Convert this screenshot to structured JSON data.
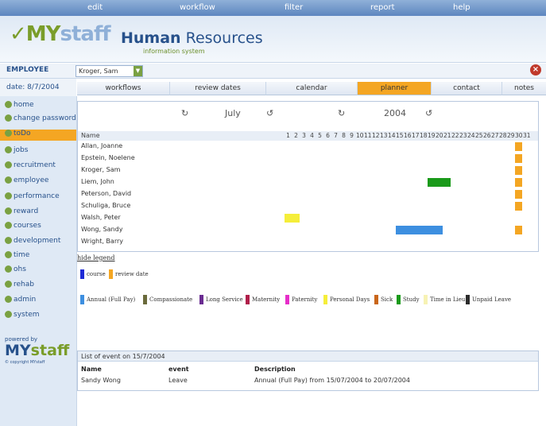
{
  "top_menu": {
    "items": [
      "edit",
      "workflow",
      "filter",
      "report",
      "help"
    ]
  },
  "header": {
    "logo_my": "MY",
    "logo_staff": "staff",
    "title_bold": "Human",
    "title_rest": " Resources",
    "subtitle": "information system"
  },
  "employee": {
    "label": "EMPLOYEE",
    "selected": "Kroger, Sam"
  },
  "date_label": "date: 8/7/2004",
  "tabs": [
    {
      "label": "workflows",
      "active": false
    },
    {
      "label": "review dates",
      "active": false
    },
    {
      "label": "calendar",
      "active": false
    },
    {
      "label": "planner",
      "active": true
    },
    {
      "label": "contact",
      "active": false
    },
    {
      "label": "notes",
      "active": false
    }
  ],
  "sidebar": {
    "items": [
      {
        "label": "home",
        "active": false
      },
      {
        "label": "change password",
        "active": false
      },
      {
        "label": "toDo",
        "active": true
      },
      {
        "label": "jobs",
        "active": false
      },
      {
        "label": "recruitment",
        "active": false
      },
      {
        "label": "employee",
        "active": false
      },
      {
        "label": "performance",
        "active": false
      },
      {
        "label": "reward",
        "active": false
      },
      {
        "label": "courses",
        "active": false
      },
      {
        "label": "development",
        "active": false
      },
      {
        "label": "time",
        "active": false
      },
      {
        "label": "ohs",
        "active": false
      },
      {
        "label": "rehab",
        "active": false
      },
      {
        "label": "admin",
        "active": false
      },
      {
        "label": "system",
        "active": false
      }
    ],
    "powered_by": "powered by",
    "logo_my": "MY",
    "logo_staff": "staff",
    "copyright": "© copyright MYstaff"
  },
  "planner": {
    "month": "July",
    "year": "2004",
    "name_header": "Name",
    "days": [
      "1",
      "2",
      "3",
      "4",
      "5",
      "6",
      "7",
      "8",
      "9",
      "10",
      "11",
      "12",
      "13",
      "14",
      "15",
      "16",
      "17",
      "18",
      "19",
      "20",
      "21",
      "22",
      "23",
      "24",
      "25",
      "26",
      "27",
      "28",
      "29",
      "30",
      "31"
    ],
    "employees": [
      {
        "name": "Allan, Joanne",
        "events": [
          {
            "type": "review",
            "start": 30,
            "end": 30
          }
        ]
      },
      {
        "name": "Epstein, Noelene",
        "events": [
          {
            "type": "review",
            "start": 30,
            "end": 30
          }
        ]
      },
      {
        "name": "Kroger, Sam",
        "events": [
          {
            "type": "review",
            "start": 30,
            "end": 30
          }
        ]
      },
      {
        "name": "Liem, John",
        "events": [
          {
            "type": "study",
            "start": 19,
            "end": 21
          },
          {
            "type": "review",
            "start": 30,
            "end": 30
          }
        ]
      },
      {
        "name": "Peterson, David",
        "events": [
          {
            "type": "review",
            "start": 30,
            "end": 30
          }
        ]
      },
      {
        "name": "Schuliga, Bruce",
        "events": [
          {
            "type": "review",
            "start": 30,
            "end": 30
          }
        ]
      },
      {
        "name": "Walsh, Peter",
        "events": [
          {
            "type": "personal",
            "start": 1,
            "end": 2
          }
        ]
      },
      {
        "name": "Wong, Sandy",
        "events": [
          {
            "type": "annual",
            "start": 15,
            "end": 20
          },
          {
            "type": "review",
            "start": 30,
            "end": 30
          }
        ]
      },
      {
        "name": "Wright, Barry",
        "events": []
      }
    ]
  },
  "legend": {
    "title": "hide legend",
    "row1": [
      {
        "label": "course",
        "color": "#1f2bd6"
      },
      {
        "label": "review date",
        "color": "#f4a623"
      }
    ],
    "row2": [
      {
        "label": "Annual (Full Pay)",
        "color": "#3d8fe0"
      },
      {
        "label": "Compassionate",
        "color": "#6b6b3c"
      },
      {
        "label": "Long Service",
        "color": "#6a2c91"
      },
      {
        "label": "Maternity",
        "color": "#b01e4a"
      },
      {
        "label": "Paternity",
        "color": "#e62ec9"
      },
      {
        "label": "Personal Days",
        "color": "#f5ee3a"
      },
      {
        "label": "Sick",
        "color": "#c9661a"
      },
      {
        "label": "Study",
        "color": "#1a9a1a"
      },
      {
        "label": "Time in Lieu",
        "color": "#f7f2b4"
      },
      {
        "label": "Unpaid Leave",
        "color": "#2b2b2b"
      }
    ]
  },
  "event_colors": {
    "review": "#f4a623",
    "study": "#1a9a1a",
    "personal": "#f5ee3a",
    "annual": "#3d8fe0"
  },
  "events_list": {
    "header": "List of event on 15/7/2004",
    "col_name": "Name",
    "col_event": "event",
    "col_desc": "Description",
    "rows": [
      {
        "name": "Sandy Wong",
        "event": "Leave",
        "description": "Annual (Full Pay) from 15/07/2004 to 20/07/2004"
      }
    ]
  }
}
